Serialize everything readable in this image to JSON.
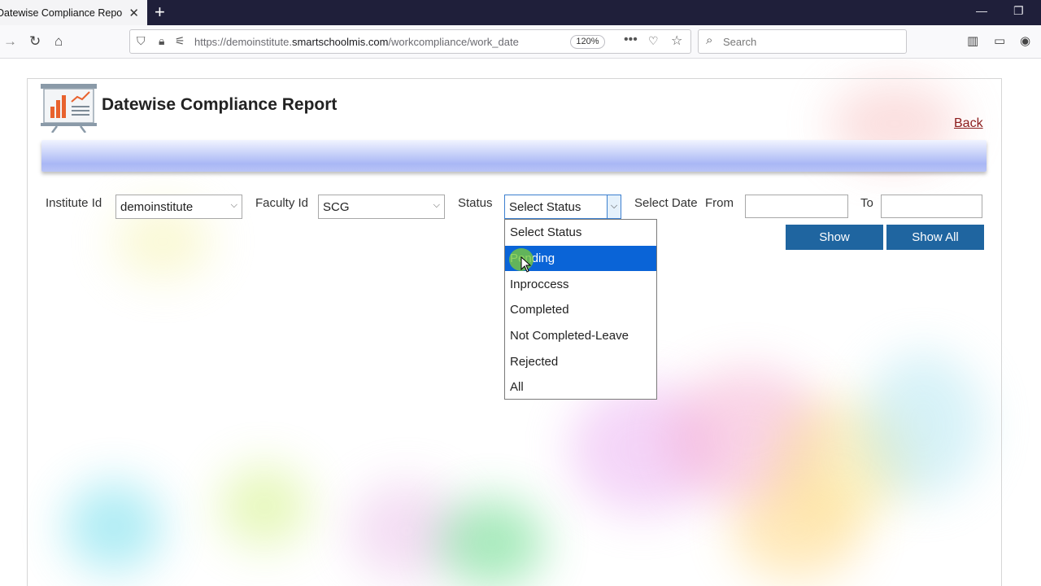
{
  "browser": {
    "tab_title": "Datewise Compliance Report",
    "url_prefix": "https://demoinstitute.",
    "url_domain": "smartschoolmis.com",
    "url_path": "/workcompliance/work_date",
    "zoom": "120%",
    "search_placeholder": "Search",
    "colors": {
      "titlebar": "#1f1f3a",
      "tab": "#f4f4f6"
    }
  },
  "page": {
    "title": "Datewise Compliance Report",
    "back_label": "Back"
  },
  "filters": {
    "institute_label": "Institute Id",
    "institute_value": "demoinstitute",
    "faculty_label": "Faculty Id",
    "faculty_value": "SCG",
    "status_label": "Status",
    "status_value": "Select Status",
    "date_label": "Select Date",
    "from_label": "From",
    "from_value": "",
    "to_label": "To",
    "to_value": ""
  },
  "buttons": {
    "show": "Show",
    "show_all": "Show All",
    "color": "#1f65a0"
  },
  "status_dropdown": {
    "options": [
      "Select Status",
      "Pending",
      "Inproccess",
      "Completed",
      "Not Completed-Leave",
      "Rejected",
      "All"
    ],
    "highlighted": "Pending",
    "highlight_color": "#0a64d7"
  }
}
